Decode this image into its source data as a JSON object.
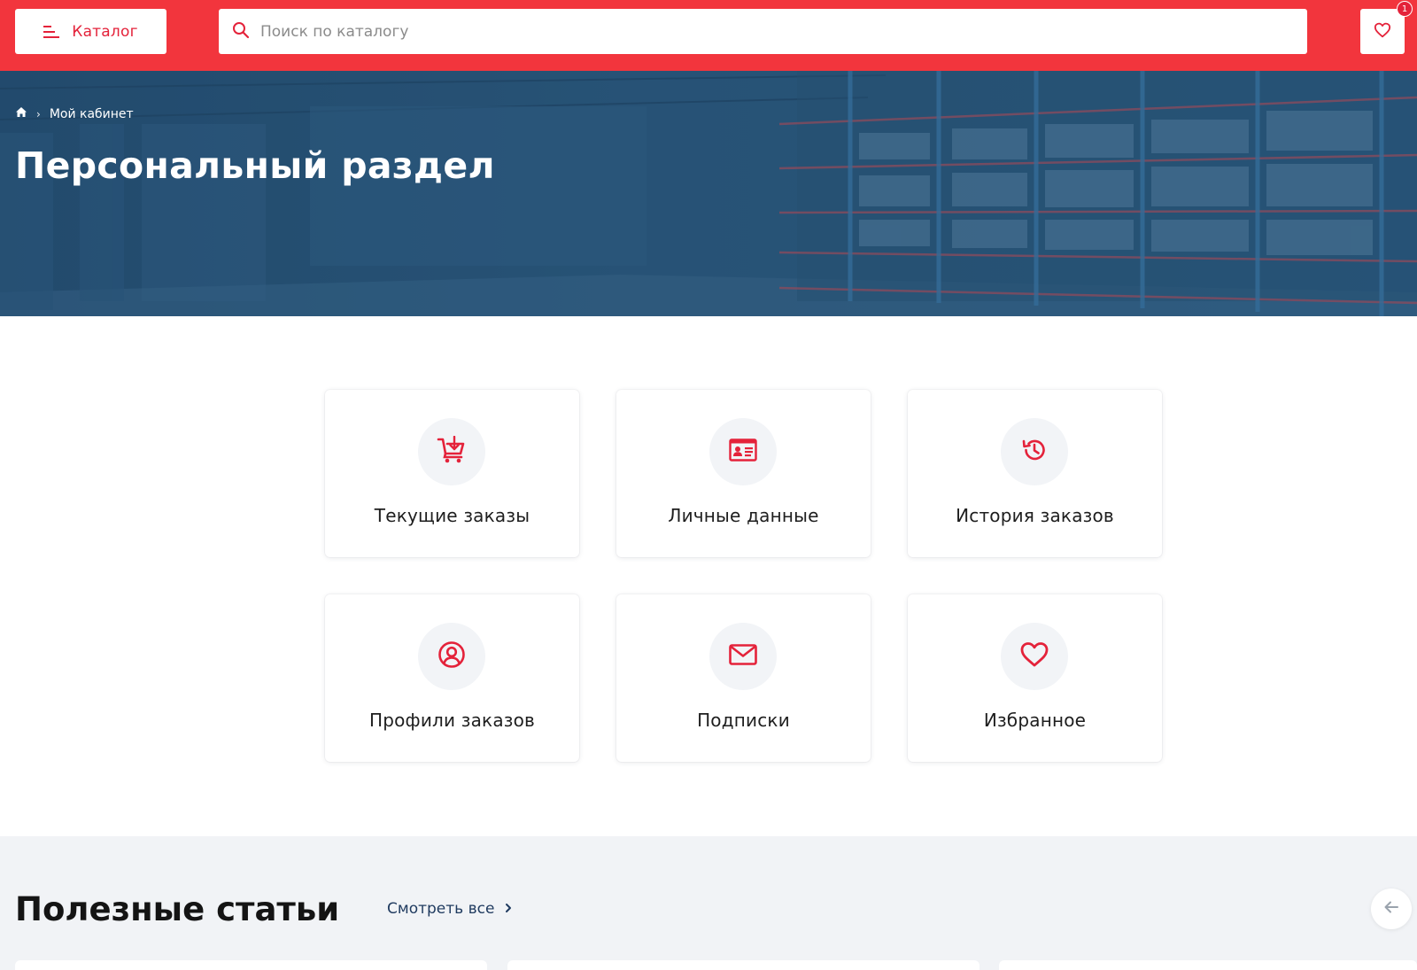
{
  "header": {
    "catalog_label": "Каталог",
    "search_placeholder": "Поиск по каталогу",
    "favorites_count": "1"
  },
  "breadcrumb": {
    "items": [
      "Мой кабинет"
    ]
  },
  "page": {
    "title": "Персональный раздел"
  },
  "cards": [
    {
      "label": "Текущие заказы",
      "icon": "cart-add-icon"
    },
    {
      "label": "Личные данные",
      "icon": "id-card-icon"
    },
    {
      "label": "История заказов",
      "icon": "history-icon"
    },
    {
      "label": "Профили заказов",
      "icon": "user-circle-icon"
    },
    {
      "label": "Подписки",
      "icon": "envelope-icon"
    },
    {
      "label": "Избранное",
      "icon": "heart-icon"
    }
  ],
  "articles": {
    "title": "Полезные статьи",
    "see_all": "Смотреть все"
  },
  "colors": {
    "accent": "#f2353d",
    "icon_red": "#e4223a",
    "hero_overlay": "#1f4a70"
  }
}
